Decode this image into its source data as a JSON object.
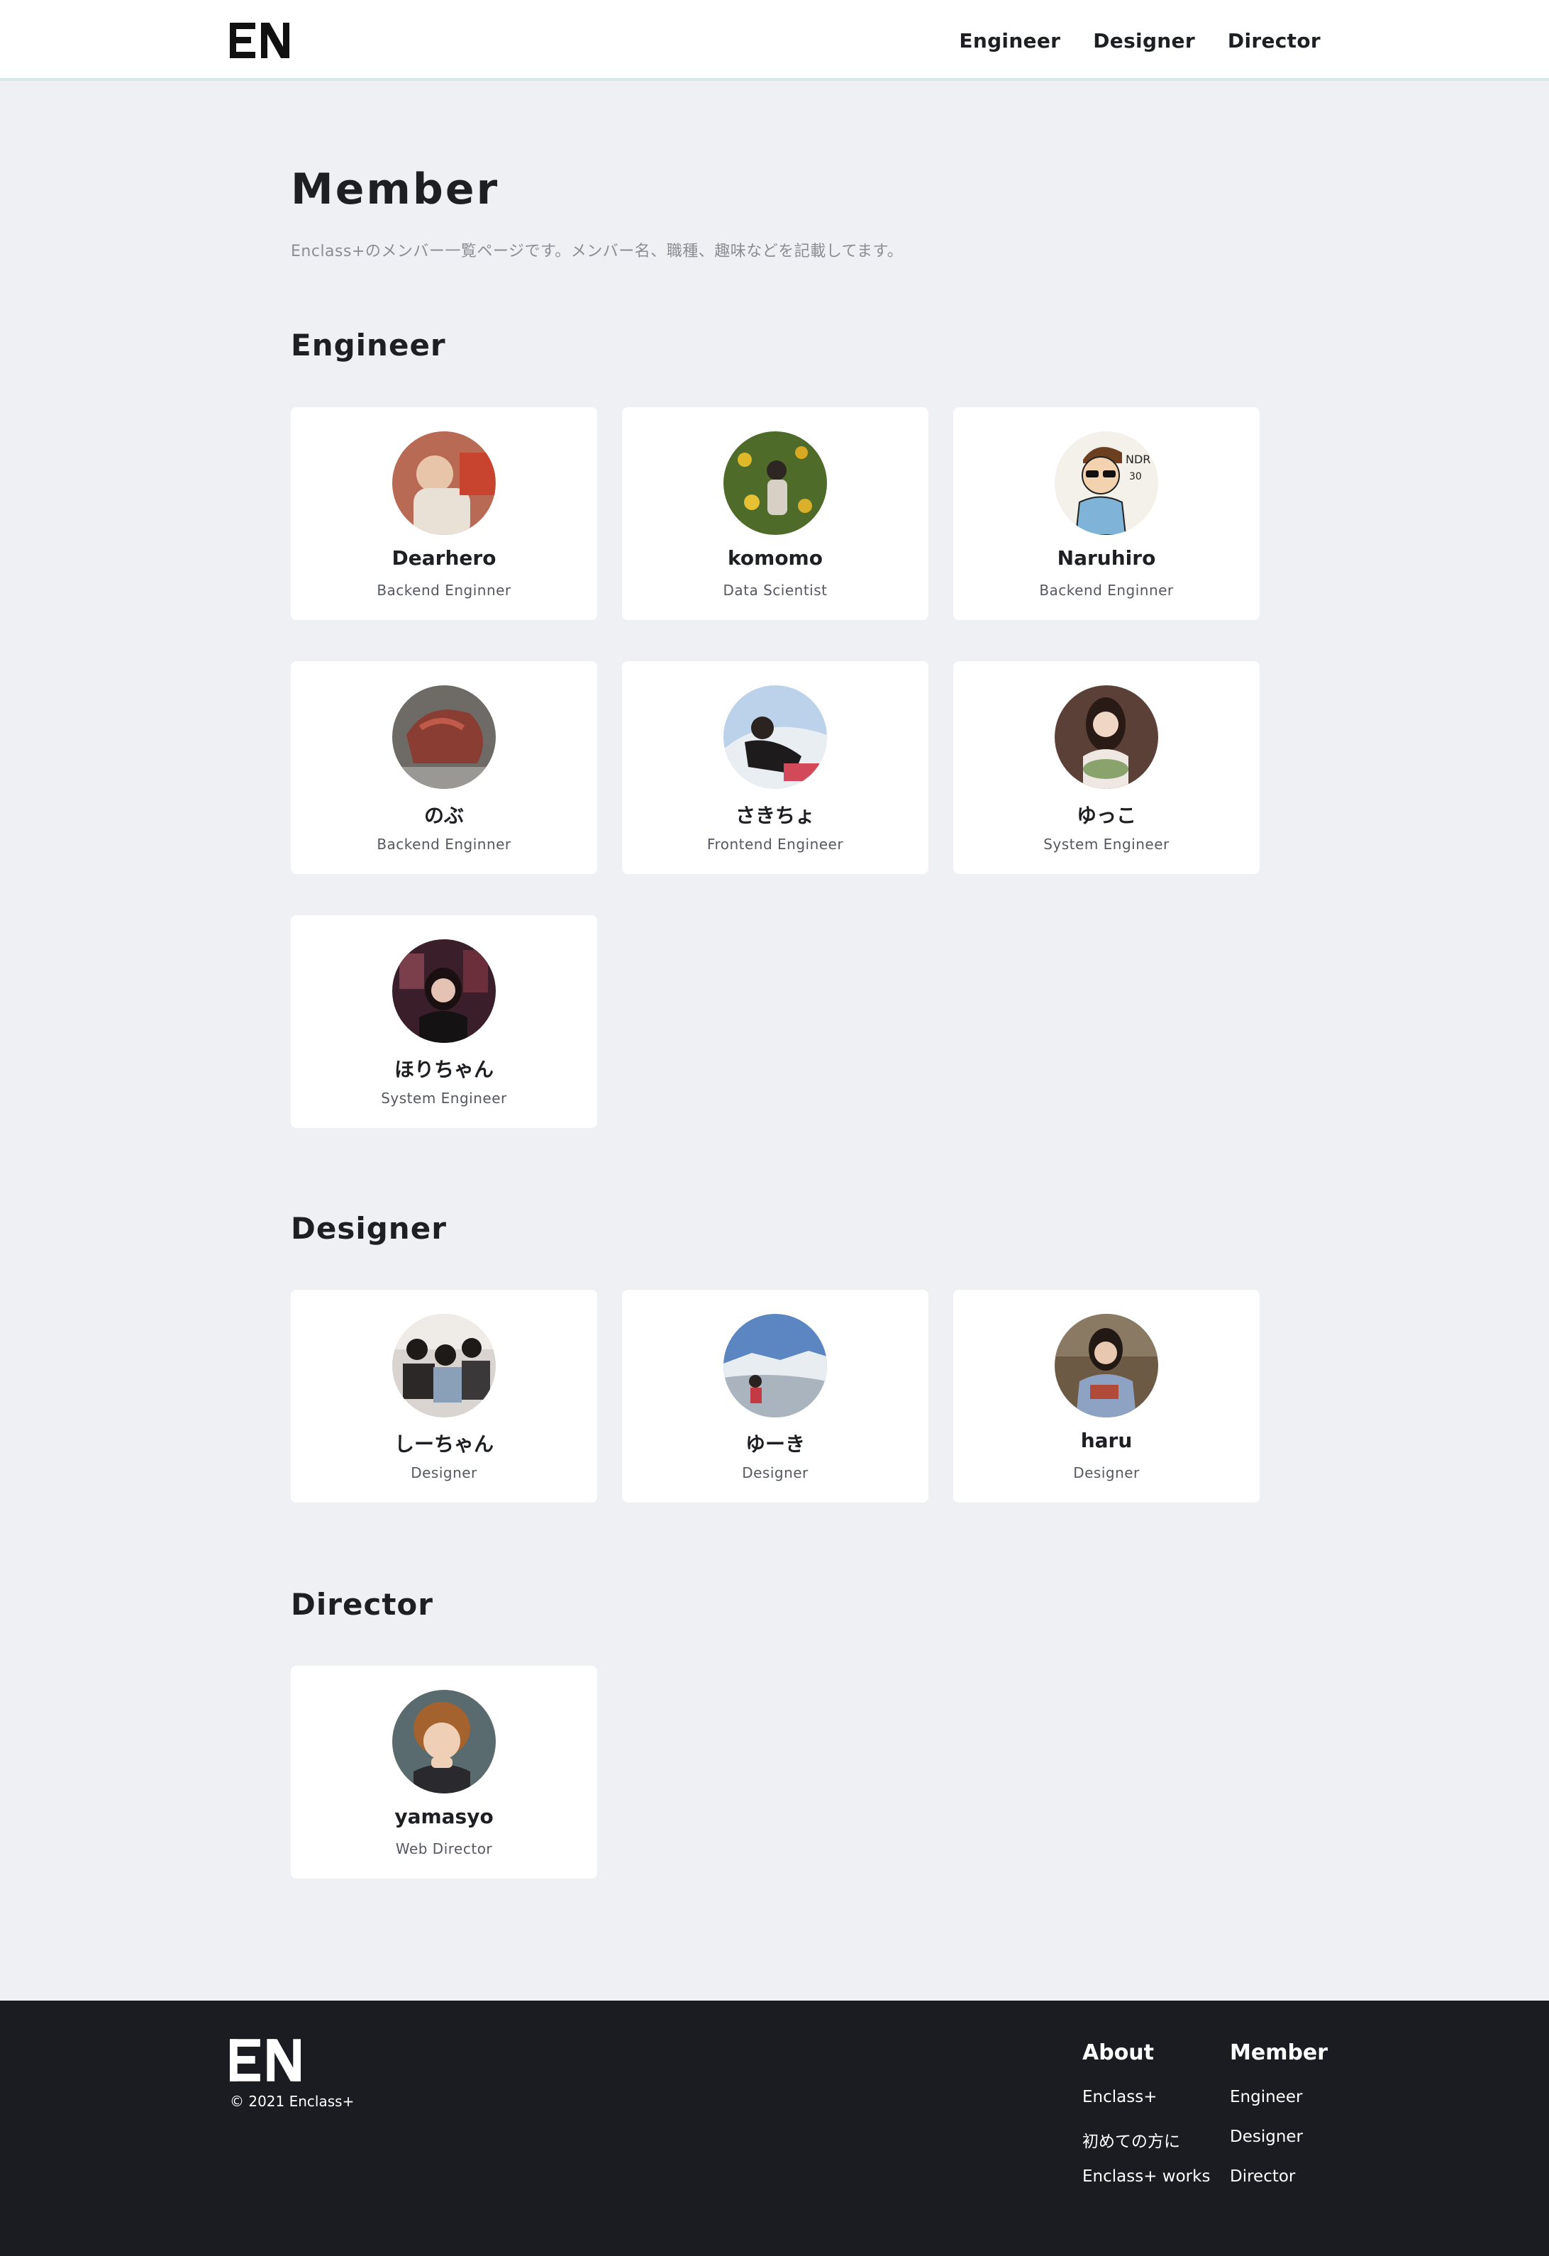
{
  "header": {
    "logo_text": "EN",
    "nav": [
      "Engineer",
      "Designer",
      "Director"
    ]
  },
  "intro": {
    "title": "Member",
    "description": "Enclass+のメンバー一覧ページです。メンバー名、職種、趣味などを記載してます。"
  },
  "sections": [
    {
      "title": "Engineer",
      "members": [
        {
          "name": "Dearhero",
          "role": "Backend Enginner",
          "avatar": "photo-avatar"
        },
        {
          "name": "komomo",
          "role": "Data Scientist",
          "avatar": "photo-avatar"
        },
        {
          "name": "Naruhiro",
          "role": "Backend Enginner",
          "avatar": "illustration-avatar"
        },
        {
          "name": "のぶ",
          "role": "Backend Enginner",
          "avatar": "photo-avatar"
        },
        {
          "name": "さきちょ",
          "role": "Frontend Engineer",
          "avatar": "photo-avatar"
        },
        {
          "name": "ゆっこ",
          "role": "System Engineer",
          "avatar": "photo-avatar"
        },
        {
          "name": "ほりちゃん",
          "role": "System Engineer",
          "avatar": "photo-avatar"
        }
      ]
    },
    {
      "title": "Designer",
      "members": [
        {
          "name": "しーちゃん",
          "role": "Designer",
          "avatar": "photo-avatar"
        },
        {
          "name": "ゆーき",
          "role": "Designer",
          "avatar": "photo-avatar"
        },
        {
          "name": "haru",
          "role": "Designer",
          "avatar": "photo-avatar"
        }
      ]
    },
    {
      "title": "Director",
      "members": [
        {
          "name": "yamasyo",
          "role": "Web Director",
          "avatar": "photo-avatar"
        }
      ]
    }
  ],
  "footer": {
    "copyright": "© 2021 Enclass+",
    "columns": [
      {
        "title": "About",
        "links": [
          "Enclass+",
          "初めての方に",
          "Enclass+ works"
        ]
      },
      {
        "title": "Member",
        "links": [
          "Engineer",
          "Designer",
          "Director"
        ]
      }
    ]
  },
  "colors": {
    "background": "#eef0f4",
    "card": "#ffffff",
    "footer": "#1b1c21",
    "text": "#1e1f22"
  }
}
